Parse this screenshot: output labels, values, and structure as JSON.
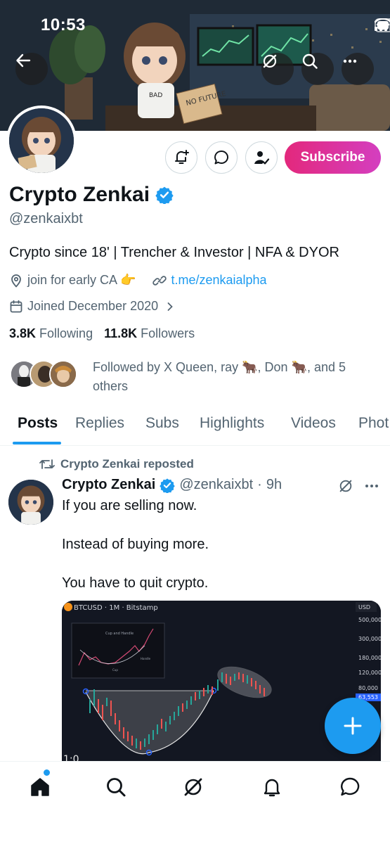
{
  "status_bar": {
    "time": "10:53"
  },
  "profile": {
    "display_name": "Crypto Zenkai",
    "handle": "@zenkaixbt",
    "bio": "Crypto since 18' | Trencher & Investor | NFA & DYOR",
    "location": "join for early CA 👉",
    "link": "t.me/zenkaialpha",
    "joined": "Joined December 2020",
    "following_count": "3.8K",
    "following_label": "Following",
    "followers_count": "11.8K",
    "followers_label": "Followers",
    "followed_by": "Followed by X Queen, ray 🐂, Don 🐂, and 5 others",
    "subscribe_label": "Subscribe",
    "banner_sign_text": "NO FUTURE",
    "banner_shirt_text": "BAD"
  },
  "tabs": [
    {
      "label": "Posts",
      "active": true
    },
    {
      "label": "Replies"
    },
    {
      "label": "Subs"
    },
    {
      "label": "Highlights"
    },
    {
      "label": "Videos"
    },
    {
      "label": "Phot"
    }
  ],
  "post": {
    "repost_label": "Crypto Zenkai reposted",
    "author_name": "Crypto Zenkai",
    "author_handle": "@zenkaixbt",
    "separator": "·",
    "time": "9h",
    "lines": [
      "If you are selling now.",
      "Instead of buying more.",
      "You have to quit crypto."
    ],
    "media": {
      "symbol": "BTCUSD · 1M · Bitstamp",
      "currency": "USD",
      "price_levels": [
        "500,000",
        "300,000",
        "180,000",
        "120,000",
        "80,000",
        "63,553"
      ],
      "inset_title": "Cup and Handle",
      "inset_label_left": "Cup",
      "inset_label_right": "Handle",
      "bottom_text": "1:0"
    }
  },
  "icons": {
    "back": "back-arrow-icon",
    "grok": "grok-icon",
    "search": "search-icon",
    "more": "more-icon",
    "bell": "notification-bell-icon",
    "message": "message-icon",
    "follow": "followed-user-icon",
    "verified": "verified-badge-icon",
    "location": "location-pin-icon",
    "link": "link-icon",
    "calendar": "calendar-icon",
    "repost": "repost-icon",
    "compose": "plus-icon",
    "home": "home-icon",
    "communities": "communities-icon"
  },
  "colors": {
    "accent": "#1d9bf0",
    "subscribe_start": "#e3287c",
    "subscribe_end": "#d43fc0",
    "text_primary": "#0f1419",
    "text_secondary": "#536471"
  }
}
